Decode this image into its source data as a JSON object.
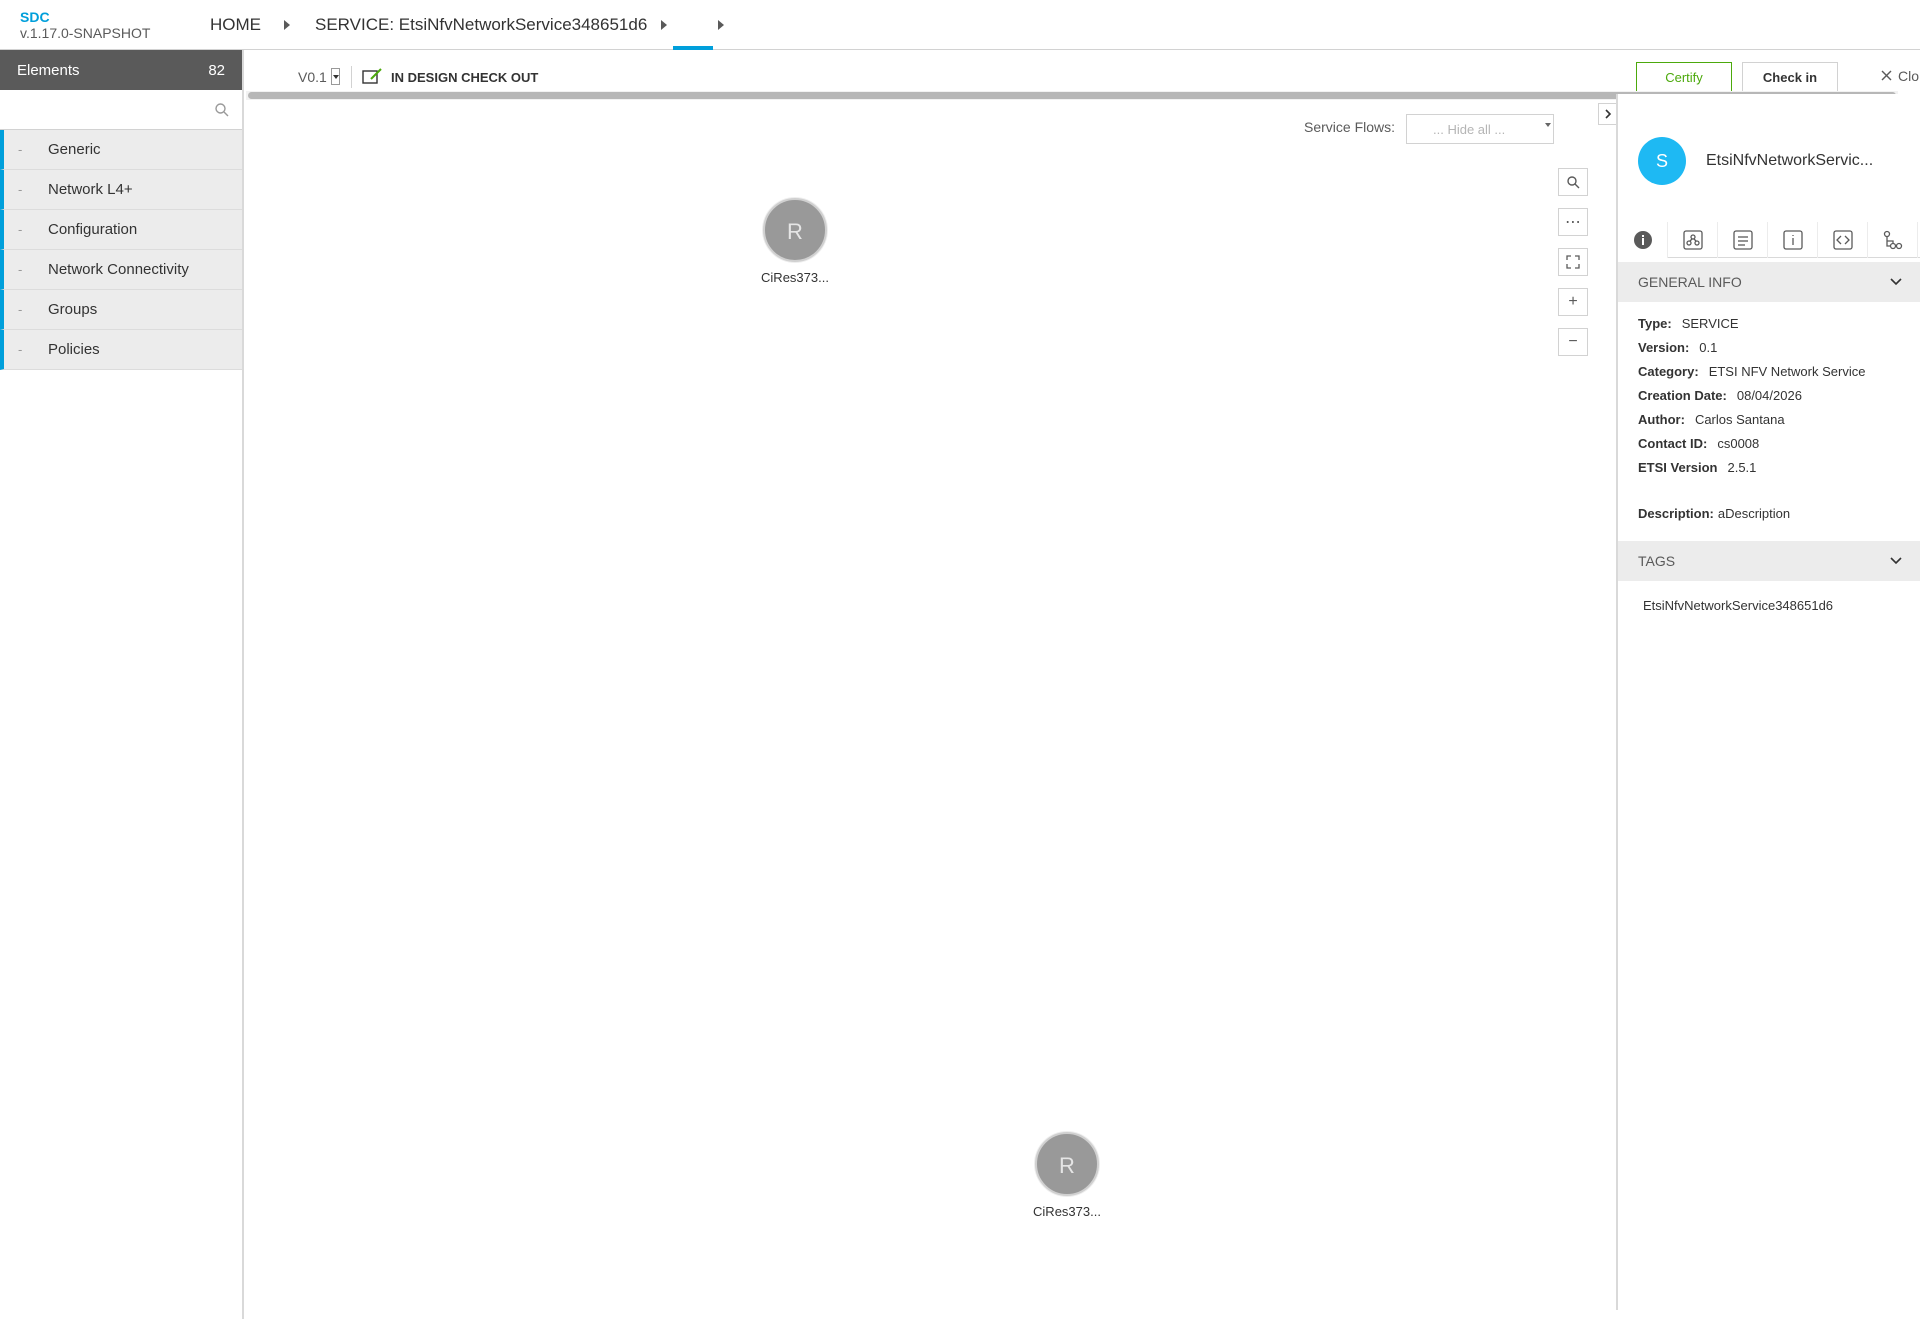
{
  "brand": {
    "name": "SDC",
    "version": "v.1.17.0-SNAPSHOT"
  },
  "breadcrumb": {
    "home": "HOME",
    "service": "SERVICE: EtsiNfvNetworkService348651d6"
  },
  "palette": {
    "title": "Elements",
    "count": "82",
    "search_placeholder": "",
    "categories": [
      "Generic",
      "Network L4+",
      "Configuration",
      "Network Connectivity",
      "Groups",
      "Policies"
    ]
  },
  "toolbar": {
    "version": "V0.1",
    "status": "IN DESIGN CHECK OUT",
    "certify": "Certify",
    "checkin": "Check in",
    "close": "Clo"
  },
  "canvas": {
    "service_flows_label": "Service Flows:",
    "service_flows_value": "... Hide all ...",
    "nodes": [
      {
        "letter": "R",
        "label": "CiRes373..."
      },
      {
        "letter": "R",
        "label": "CiRes373..."
      }
    ]
  },
  "panel": {
    "avatar_letter": "S",
    "title": "EtsiNfvNetworkServic...",
    "general_info_title": "GENERAL INFO",
    "info": [
      {
        "key": "Type:",
        "value": "SERVICE"
      },
      {
        "key": "Version:",
        "value": "0.1"
      },
      {
        "key": "Category:",
        "value": "ETSI NFV Network Service"
      },
      {
        "key": "Creation Date:",
        "value": "08/04/2026"
      },
      {
        "key": "Author:",
        "value": "Carlos Santana"
      },
      {
        "key": "Contact ID:",
        "value": "cs0008"
      },
      {
        "key": "ETSI Version",
        "value": "2.5.1"
      }
    ],
    "description_key": "Description:",
    "description_value": "aDescription",
    "tags_title": "TAGS",
    "tags": [
      "EtsiNfvNetworkService348651d6"
    ]
  },
  "colors": {
    "accent": "#009fdb",
    "certify": "#4ca90c",
    "header_dark": "#5a5a5a",
    "avatar": "#1eb9f3"
  }
}
